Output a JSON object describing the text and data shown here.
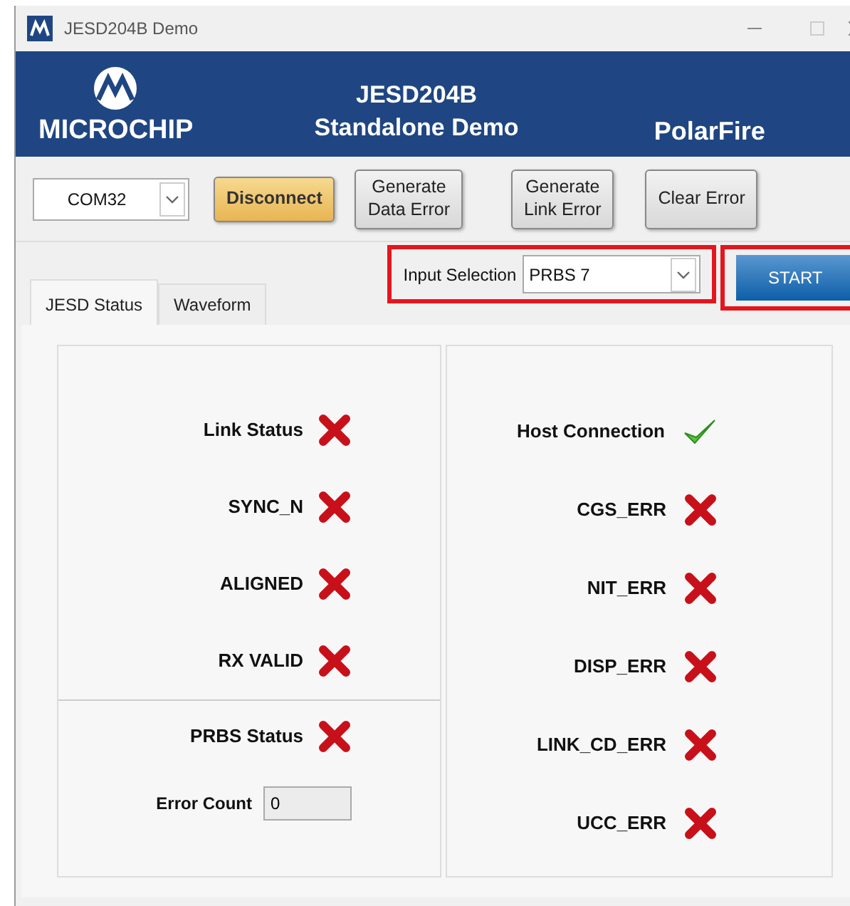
{
  "window": {
    "title": "JESD204B Demo"
  },
  "banner": {
    "logo": "MICROCHIP",
    "title_line_1": "JESD204B",
    "title_line_2": "Standalone Demo",
    "product": "PolarFire"
  },
  "toolbar": {
    "port": "COM32",
    "buttons": [
      {
        "label": "Disconnect",
        "kind": "accent"
      },
      {
        "label": "Generate\nData Error",
        "kind": "plain"
      },
      {
        "label": "Generate\nLink Error",
        "kind": "plain"
      },
      {
        "label": "Clear Error",
        "kind": "plain"
      }
    ]
  },
  "tabs": [
    {
      "label": "JESD Status",
      "selected": true
    },
    {
      "label": "Waveform",
      "selected": false
    }
  ],
  "input_selection": {
    "label": "Input Selection",
    "value": "PRBS 7",
    "highlighted": true
  },
  "start_button": {
    "label": "START",
    "highlighted": true
  },
  "left_status": [
    {
      "label": "Link Status",
      "ok": false
    },
    {
      "label": "SYNC_N",
      "ok": false
    },
    {
      "label": "ALIGNED",
      "ok": false
    },
    {
      "label": "RX VALID",
      "ok": false
    }
  ],
  "prbs": {
    "label": "PRBS Status",
    "ok": false,
    "error_count_label": "Error Count",
    "error_count": "0"
  },
  "right_status": [
    {
      "label": "Host Connection",
      "ok": true
    },
    {
      "label": "CGS_ERR",
      "ok": false
    },
    {
      "label": "NIT_ERR",
      "ok": false
    },
    {
      "label": "DISP_ERR",
      "ok": false
    },
    {
      "label": "LINK_CD_ERR",
      "ok": false
    },
    {
      "label": "UCC_ERR",
      "ok": false
    }
  ]
}
